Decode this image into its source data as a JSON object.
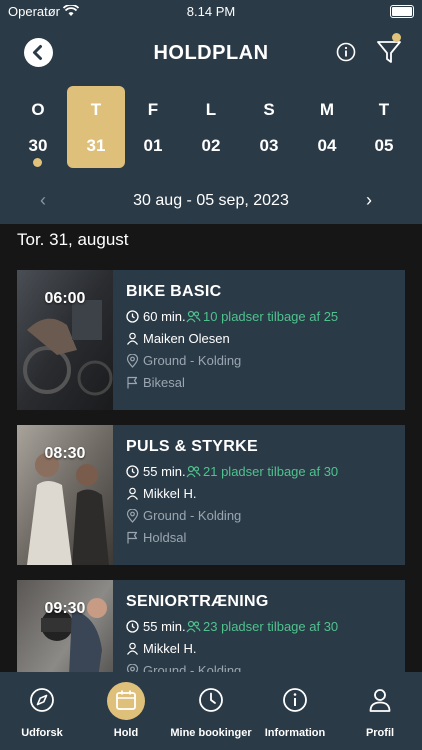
{
  "status": {
    "carrier": "Operatør",
    "time": "8.14 PM"
  },
  "header": {
    "title": "HOLDPLAN"
  },
  "days": [
    {
      "letter": "O",
      "number": "30",
      "selected": false,
      "dot": true
    },
    {
      "letter": "T",
      "number": "31",
      "selected": true,
      "dot": false
    },
    {
      "letter": "F",
      "number": "01",
      "selected": false,
      "dot": false
    },
    {
      "letter": "L",
      "number": "02",
      "selected": false,
      "dot": false
    },
    {
      "letter": "S",
      "number": "03",
      "selected": false,
      "dot": false
    },
    {
      "letter": "M",
      "number": "04",
      "selected": false,
      "dot": false
    },
    {
      "letter": "T",
      "number": "05",
      "selected": false,
      "dot": false
    }
  ],
  "range": {
    "label": "30 aug - 05 sep, 2023",
    "prev": "‹",
    "next": "›"
  },
  "day_heading": "Tor. 31, august",
  "classes": [
    {
      "time": "06:00",
      "name": "BIKE BASIC",
      "duration": "60 min.",
      "spots": "10 pladser tilbage af 25",
      "instructor": "Maiken Olesen",
      "location": "Ground - Kolding",
      "room": "Bikesal"
    },
    {
      "time": "08:30",
      "name": "PULS & STYRKE",
      "duration": "55 min.",
      "spots": "21 pladser tilbage af 30",
      "instructor": "Mikkel H.",
      "location": "Ground - Kolding",
      "room": "Holdsal"
    },
    {
      "time": "09:30",
      "name": "SENIORTRÆNING",
      "duration": "55 min.",
      "spots": "23 pladser tilbage af 30",
      "instructor": "Mikkel H.",
      "location": "Ground - Kolding",
      "room": ""
    }
  ],
  "tabs": [
    {
      "label": "Udforsk",
      "icon": "compass-icon"
    },
    {
      "label": "Hold",
      "icon": "calendar-icon"
    },
    {
      "label": "Mine bookinger",
      "icon": "clock-icon"
    },
    {
      "label": "Information",
      "icon": "info-icon"
    },
    {
      "label": "Profil",
      "icon": "person-icon"
    }
  ],
  "colors": {
    "header_bg": "#2b3a47",
    "accent": "#dfc07a",
    "green": "#4fc28e",
    "page_bg": "#161616"
  }
}
